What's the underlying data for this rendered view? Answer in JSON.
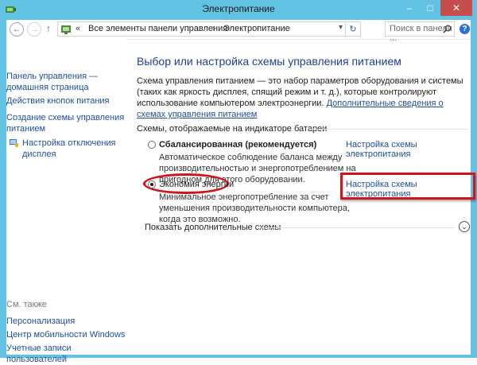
{
  "window": {
    "title": "Электропитание",
    "controls": {
      "minimize": "–",
      "maximize": "□",
      "close": "✕"
    }
  },
  "addressbar": {
    "back_icon": "←",
    "forward_icon": "→",
    "up_icon": "↑",
    "overflow": "«",
    "crumbs": [
      "Все элементы панели управления",
      "Электропитание"
    ],
    "separator": "›",
    "dropdown_icon": "▾",
    "refresh_icon": "↻",
    "search_placeholder": "Поиск в панели ...",
    "help_icon": "?"
  },
  "sidebar": {
    "links": [
      "Панель управления —\nдомашняя страница",
      "Действия кнопок питания",
      "Создание схемы управления\nпитанием",
      "Настройка отключения\nдисплея"
    ],
    "see_also_heading": "См. также",
    "see_also": [
      "Персонализация",
      "Центр мобильности Windows",
      "Учетные записи\nпользователей"
    ]
  },
  "main": {
    "title": "Выбор или настройка схемы управления питанием",
    "description": "Схема управления питанием — это набор параметров оборудования и системы (таких как яркость дисплея, спящий режим и т. д.), которые контролируют использование компьютером электроэнергии.",
    "description_link": "Дополнительные сведения о схемах управления питанием",
    "group_header": "Схемы, отображаемые на индикаторе батареи",
    "plans": [
      {
        "name": "Сбалансированная (рекомендуется)",
        "description": "Автоматическое соблюдение баланса между производительностью и энергопотреблением на пригодном для этого оборудовании.",
        "link": "Настройка схемы электропитания",
        "selected": false
      },
      {
        "name": "Экономия энергии",
        "description": "Минимальное энергопотребление за счет уменьшения производительности компьютера, когда это возможно.",
        "link": "Настройка схемы электропитания",
        "selected": true
      }
    ],
    "more_label": "Показать дополнительные схемы",
    "more_icon": "⌄"
  },
  "colors": {
    "title_bar": "#62c2e4",
    "close_button": "#c74d4d",
    "link": "#1c4f9c",
    "heading": "#1e3f8f",
    "annotation": "#d0161b"
  }
}
